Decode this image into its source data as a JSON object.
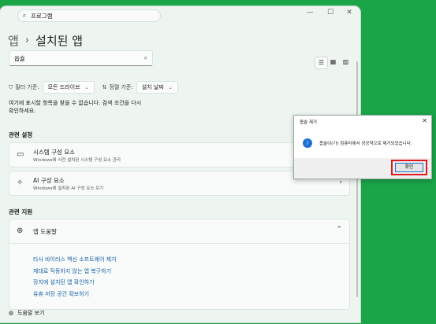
{
  "titlebar": {
    "search_value": "프로그램"
  },
  "breadcrumb": {
    "parent": "앱",
    "separator": "›",
    "current": "설치된 앱"
  },
  "app_search": {
    "value": "옵슐"
  },
  "filters": {
    "filter_label": "필터 기준:",
    "filter_value": "모든 드라이브",
    "sort_label": "정렬 기준:",
    "sort_value": "설치 날짜"
  },
  "empty_message": "여기에 표시할 항목을 찾을 수 없습니다. 검색 조건을 다시 확인하세요.",
  "related_settings": {
    "heading": "관련 설정",
    "items": [
      {
        "title": "시스템 구성 요소",
        "desc": "Windows에 사전 설치된 시스템 구성 요소 관리",
        "icon": "system-components-icon"
      },
      {
        "title": "AI 구성 요소",
        "desc": "Windows에 설치된 AI 구성 요소 보기",
        "icon": "sparkle-icon"
      }
    ]
  },
  "related_support": {
    "heading": "관련 지원",
    "help_title": "앱 도움말",
    "links": [
      "타사 바이러스 백신 소프트웨어 제거",
      "제대로 작동하지 않는 앱 복구하기",
      "장치에 설치된 앱 확인하기",
      "유휴 저장 공간 확보하기"
    ]
  },
  "bottom_link": "도움말 보기",
  "dialog": {
    "title": "옵슐 제거",
    "message": "옵슐이(가) 컴퓨터에서 성공적으로 제거되었습니다.",
    "ok_label": "확인"
  },
  "colors": {
    "desktop": "#1aa548",
    "window": "#eef5f0",
    "link": "#1a5fa8",
    "highlight": "#e0181f",
    "info": "#1c6fd1"
  }
}
